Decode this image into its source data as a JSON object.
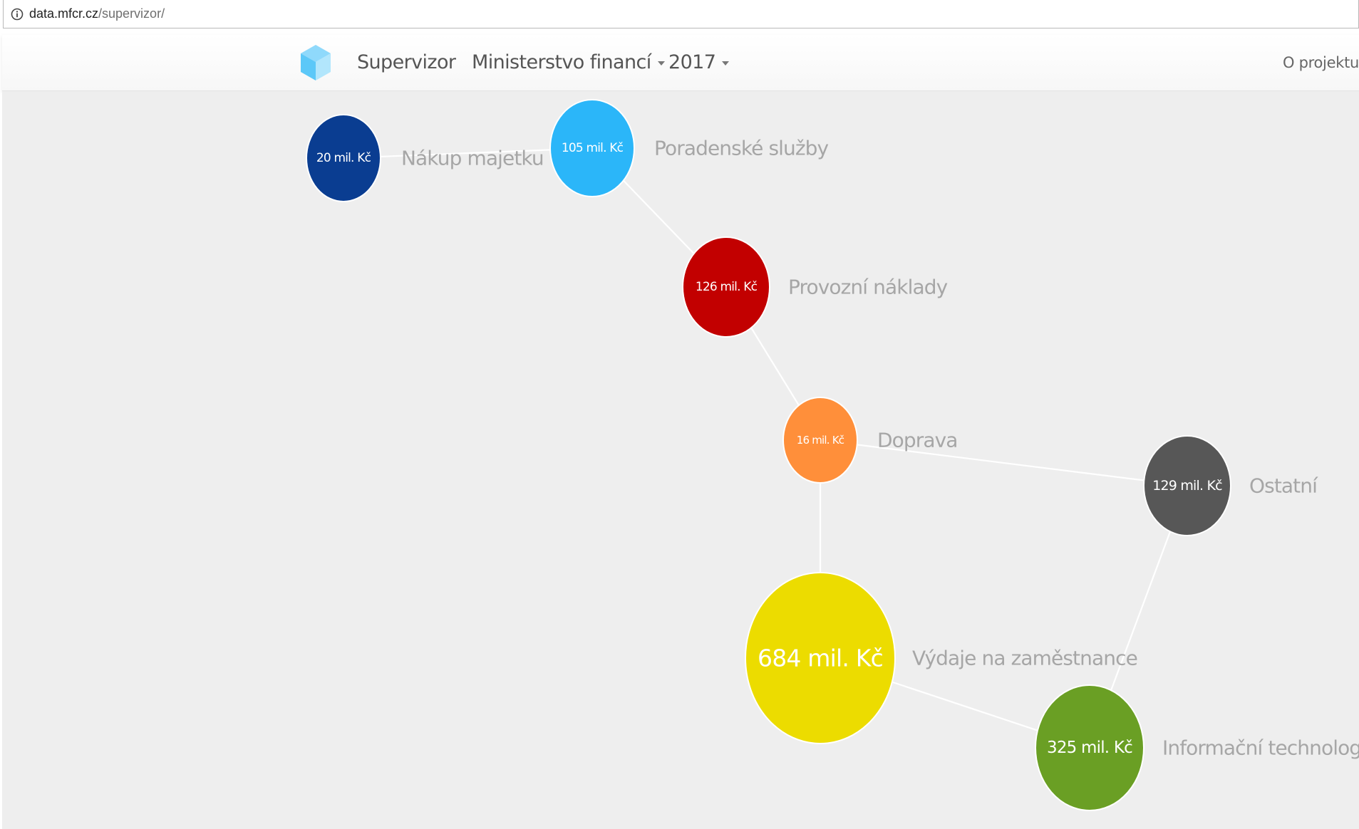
{
  "browser": {
    "url_domain": "data.mfcr.cz",
    "url_path": "/supervizor/"
  },
  "navbar": {
    "brand": "Supervizor",
    "ministry": "Ministerstvo financí",
    "year": "2017",
    "about": "O projektu"
  },
  "graph": {
    "nodes": [
      {
        "id": "nakup-majetku",
        "value": "20 mil. Kč",
        "label": "Nákup majetku",
        "color": "#0a3d91"
      },
      {
        "id": "poradenske-sluzby",
        "value": "105 mil. Kč",
        "label": "Poradenské služby",
        "color": "#2bb6f9"
      },
      {
        "id": "provozni-naklady",
        "value": "126 mil. Kč",
        "label": "Provozní náklady",
        "color": "#c20000"
      },
      {
        "id": "doprava",
        "value": "16 mil. Kč",
        "label": "Doprava",
        "color": "#ff8f3a"
      },
      {
        "id": "ostatni",
        "value": "129 mil. Kč",
        "label": "Ostatní",
        "color": "#575757"
      },
      {
        "id": "vydaje-na-zamestnance",
        "value": "684 mil. Kč",
        "label": "Výdaje na zaměstnance",
        "color": "#ecdc00"
      },
      {
        "id": "informacni-technologie",
        "value": "325 mil. Kč",
        "label": "Informační technologie",
        "color": "#6a9f24"
      }
    ],
    "edges": [
      [
        "nakup-majetku",
        "poradenske-sluzby"
      ],
      [
        "poradenske-sluzby",
        "provozni-naklady"
      ],
      [
        "provozni-naklady",
        "doprava"
      ],
      [
        "doprava",
        "ostatni"
      ],
      [
        "doprava",
        "vydaje-na-zamestnance"
      ],
      [
        "vydaje-na-zamestnance",
        "informacni-technologie"
      ],
      [
        "informacni-technologie",
        "ostatni"
      ]
    ]
  }
}
